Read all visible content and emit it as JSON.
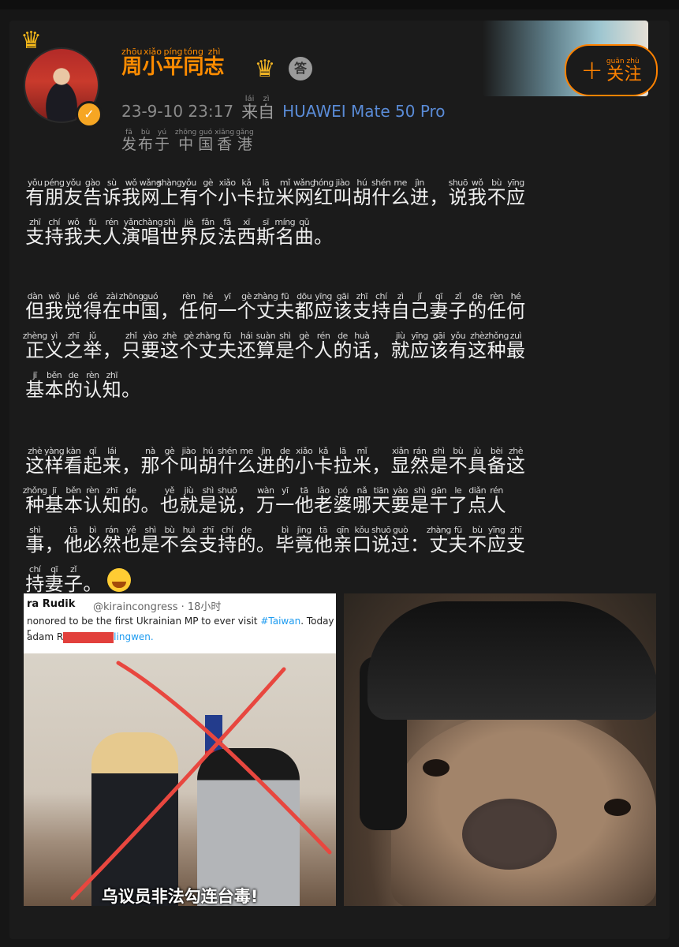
{
  "user": {
    "name": [
      {
        "py": "zhōu",
        "hz": "周"
      },
      {
        "py": "xiǎo",
        "hz": "小"
      },
      {
        "py": "píng",
        "hz": "平"
      },
      {
        "py": "tóng",
        "hz": "同"
      },
      {
        "py": "zhì",
        "hz": "志"
      }
    ],
    "timestamp": "23-9-10 23:17",
    "source_label": [
      {
        "py": "lái",
        "hz": "来"
      },
      {
        "py": "zì",
        "hz": "自"
      }
    ],
    "device": "HUAWEI Mate 50 Pro",
    "location": [
      {
        "py": "fā",
        "hz": "发"
      },
      {
        "py": "bù",
        "hz": "布"
      },
      {
        "py": "yú",
        "hz": "于"
      },
      {
        "py": "",
        "hz": " "
      },
      {
        "py": "zhōng",
        "hz": "中"
      },
      {
        "py": "guó",
        "hz": "国"
      },
      {
        "py": "xiāng",
        "hz": "香"
      },
      {
        "py": "gǎng",
        "hz": "港"
      }
    ]
  },
  "follow": {
    "label": [
      {
        "py": "guān",
        "hz": "关"
      },
      {
        "py": "zhù",
        "hz": "注"
      }
    ],
    "plus": "+"
  },
  "post": {
    "paragraphs": [
      [
        [
          {
            "py": "yǒu",
            "hz": "有"
          },
          {
            "py": "péng",
            "hz": "朋"
          },
          {
            "py": "yǒu",
            "hz": "友"
          },
          {
            "py": "gào",
            "hz": "告"
          },
          {
            "py": "sù",
            "hz": "诉"
          },
          {
            "py": "wǒ",
            "hz": "我"
          },
          {
            "py": "wǎng",
            "hz": "网"
          },
          {
            "py": "shàng",
            "hz": "上"
          },
          {
            "py": "yǒu",
            "hz": "有"
          },
          {
            "py": "gè",
            "hz": "个"
          },
          {
            "py": "xiǎo",
            "hz": "小"
          },
          {
            "py": "kǎ",
            "hz": "卡"
          },
          {
            "py": "lā",
            "hz": "拉"
          },
          {
            "py": "mǐ",
            "hz": "米"
          },
          {
            "py": "wǎng",
            "hz": "网"
          },
          {
            "py": "hóng",
            "hz": "红"
          },
          {
            "py": "jiào",
            "hz": "叫"
          },
          {
            "py": "hú",
            "hz": "胡"
          },
          {
            "py": "shén",
            "hz": "什"
          },
          {
            "py": "me",
            "hz": "么"
          },
          {
            "py": "jìn",
            "hz": "进"
          },
          {
            "py": "",
            "hz": "，"
          },
          {
            "py": "shuō",
            "hz": "说"
          },
          {
            "py": "wǒ",
            "hz": "我"
          },
          {
            "py": "bù",
            "hz": "不"
          },
          {
            "py": "yīng",
            "hz": "应"
          }
        ],
        [
          {
            "py": "zhī",
            "hz": "支"
          },
          {
            "py": "chí",
            "hz": "持"
          },
          {
            "py": "wǒ",
            "hz": "我"
          },
          {
            "py": "fū",
            "hz": "夫"
          },
          {
            "py": "rén",
            "hz": "人"
          },
          {
            "py": "yǎn",
            "hz": "演"
          },
          {
            "py": "chàng",
            "hz": "唱"
          },
          {
            "py": "shì",
            "hz": "世"
          },
          {
            "py": "jiè",
            "hz": "界"
          },
          {
            "py": "fǎn",
            "hz": "反"
          },
          {
            "py": "fǎ",
            "hz": "法"
          },
          {
            "py": "xī",
            "hz": "西"
          },
          {
            "py": "sī",
            "hz": "斯"
          },
          {
            "py": "míng",
            "hz": "名"
          },
          {
            "py": "qǔ",
            "hz": "曲"
          },
          {
            "py": "",
            "hz": "。"
          }
        ]
      ],
      [
        [
          {
            "py": "dàn",
            "hz": "但"
          },
          {
            "py": "wǒ",
            "hz": "我"
          },
          {
            "py": "jué",
            "hz": "觉"
          },
          {
            "py": "dé",
            "hz": "得"
          },
          {
            "py": "zài",
            "hz": "在"
          },
          {
            "py": "zhōng",
            "hz": "中"
          },
          {
            "py": "guó",
            "hz": "国"
          },
          {
            "py": "",
            "hz": "，"
          },
          {
            "py": "rèn",
            "hz": "任"
          },
          {
            "py": "hé",
            "hz": "何"
          },
          {
            "py": "yī",
            "hz": "一"
          },
          {
            "py": "gè",
            "hz": "个"
          },
          {
            "py": "zhàng",
            "hz": "丈"
          },
          {
            "py": "fū",
            "hz": "夫"
          },
          {
            "py": "dōu",
            "hz": "都"
          },
          {
            "py": "yīng",
            "hz": "应"
          },
          {
            "py": "gāi",
            "hz": "该"
          },
          {
            "py": "zhī",
            "hz": "支"
          },
          {
            "py": "chí",
            "hz": "持"
          },
          {
            "py": "zì",
            "hz": "自"
          },
          {
            "py": "jǐ",
            "hz": "己"
          },
          {
            "py": "qī",
            "hz": "妻"
          },
          {
            "py": "zǐ",
            "hz": "子"
          },
          {
            "py": "de",
            "hz": "的"
          },
          {
            "py": "rèn",
            "hz": "任"
          },
          {
            "py": "hé",
            "hz": "何"
          }
        ],
        [
          {
            "py": "zhèng",
            "hz": "正"
          },
          {
            "py": "yì",
            "hz": "义"
          },
          {
            "py": "zhī",
            "hz": "之"
          },
          {
            "py": "jǔ",
            "hz": "举"
          },
          {
            "py": "",
            "hz": "，"
          },
          {
            "py": "zhǐ",
            "hz": "只"
          },
          {
            "py": "yào",
            "hz": "要"
          },
          {
            "py": "zhè",
            "hz": "这"
          },
          {
            "py": "gè",
            "hz": "个"
          },
          {
            "py": "zhàng",
            "hz": "丈"
          },
          {
            "py": "fū",
            "hz": "夫"
          },
          {
            "py": "hái",
            "hz": "还"
          },
          {
            "py": "suàn",
            "hz": "算"
          },
          {
            "py": "shì",
            "hz": "是"
          },
          {
            "py": "gè",
            "hz": "个"
          },
          {
            "py": "rén",
            "hz": "人"
          },
          {
            "py": "de",
            "hz": "的"
          },
          {
            "py": "huà",
            "hz": "话"
          },
          {
            "py": "",
            "hz": "，"
          },
          {
            "py": "jiù",
            "hz": "就"
          },
          {
            "py": "yīng",
            "hz": "应"
          },
          {
            "py": "gāi",
            "hz": "该"
          },
          {
            "py": "yǒu",
            "hz": "有"
          },
          {
            "py": "zhè",
            "hz": "这"
          },
          {
            "py": "zhǒng",
            "hz": "种"
          },
          {
            "py": "zuì",
            "hz": "最"
          }
        ],
        [
          {
            "py": "jī",
            "hz": "基"
          },
          {
            "py": "běn",
            "hz": "本"
          },
          {
            "py": "de",
            "hz": "的"
          },
          {
            "py": "rèn",
            "hz": "认"
          },
          {
            "py": "zhī",
            "hz": "知"
          },
          {
            "py": "",
            "hz": "。"
          }
        ]
      ],
      [
        [
          {
            "py": "zhè",
            "hz": "这"
          },
          {
            "py": "yàng",
            "hz": "样"
          },
          {
            "py": "kàn",
            "hz": "看"
          },
          {
            "py": "qǐ",
            "hz": "起"
          },
          {
            "py": "lái",
            "hz": "来"
          },
          {
            "py": "",
            "hz": "，"
          },
          {
            "py": "nà",
            "hz": "那"
          },
          {
            "py": "gè",
            "hz": "个"
          },
          {
            "py": "jiào",
            "hz": "叫"
          },
          {
            "py": "hú",
            "hz": "胡"
          },
          {
            "py": "shén",
            "hz": "什"
          },
          {
            "py": "me",
            "hz": "么"
          },
          {
            "py": "jìn",
            "hz": "进"
          },
          {
            "py": "de",
            "hz": "的"
          },
          {
            "py": "xiǎo",
            "hz": "小"
          },
          {
            "py": "kǎ",
            "hz": "卡"
          },
          {
            "py": "lā",
            "hz": "拉"
          },
          {
            "py": "mǐ",
            "hz": "米"
          },
          {
            "py": "",
            "hz": "，"
          },
          {
            "py": "xiǎn",
            "hz": "显"
          },
          {
            "py": "rán",
            "hz": "然"
          },
          {
            "py": "shì",
            "hz": "是"
          },
          {
            "py": "bù",
            "hz": "不"
          },
          {
            "py": "jù",
            "hz": "具"
          },
          {
            "py": "bèi",
            "hz": "备"
          },
          {
            "py": "zhè",
            "hz": "这"
          }
        ],
        [
          {
            "py": "zhǒng",
            "hz": "种"
          },
          {
            "py": "jī",
            "hz": "基"
          },
          {
            "py": "běn",
            "hz": "本"
          },
          {
            "py": "rèn",
            "hz": "认"
          },
          {
            "py": "zhī",
            "hz": "知"
          },
          {
            "py": "de",
            "hz": "的"
          },
          {
            "py": "",
            "hz": "。"
          },
          {
            "py": "yě",
            "hz": "也"
          },
          {
            "py": "jiù",
            "hz": "就"
          },
          {
            "py": "shì",
            "hz": "是"
          },
          {
            "py": "shuō",
            "hz": "说"
          },
          {
            "py": "",
            "hz": "，"
          },
          {
            "py": "wàn",
            "hz": "万"
          },
          {
            "py": "yī",
            "hz": "一"
          },
          {
            "py": "tā",
            "hz": "他"
          },
          {
            "py": "lǎo",
            "hz": "老"
          },
          {
            "py": "pó",
            "hz": "婆"
          },
          {
            "py": "nǎ",
            "hz": "哪"
          },
          {
            "py": "tiān",
            "hz": "天"
          },
          {
            "py": "yào",
            "hz": "要"
          },
          {
            "py": "shì",
            "hz": "是"
          },
          {
            "py": "gān",
            "hz": "干"
          },
          {
            "py": "le",
            "hz": "了"
          },
          {
            "py": "diǎn",
            "hz": "点"
          },
          {
            "py": "rén",
            "hz": "人"
          }
        ],
        [
          {
            "py": "shì",
            "hz": "事"
          },
          {
            "py": "",
            "hz": "，"
          },
          {
            "py": "tā",
            "hz": "他"
          },
          {
            "py": "bì",
            "hz": "必"
          },
          {
            "py": "rán",
            "hz": "然"
          },
          {
            "py": "yě",
            "hz": "也"
          },
          {
            "py": "shì",
            "hz": "是"
          },
          {
            "py": "bù",
            "hz": "不"
          },
          {
            "py": "huì",
            "hz": "会"
          },
          {
            "py": "zhī",
            "hz": "支"
          },
          {
            "py": "chí",
            "hz": "持"
          },
          {
            "py": "de",
            "hz": "的"
          },
          {
            "py": "",
            "hz": "。"
          },
          {
            "py": "bì",
            "hz": "毕"
          },
          {
            "py": "jìng",
            "hz": "竟"
          },
          {
            "py": "tā",
            "hz": "他"
          },
          {
            "py": "qīn",
            "hz": "亲"
          },
          {
            "py": "kǒu",
            "hz": "口"
          },
          {
            "py": "shuō",
            "hz": "说"
          },
          {
            "py": "guò",
            "hz": "过"
          },
          {
            "py": "",
            "hz": "："
          },
          {
            "py": "zhàng",
            "hz": "丈"
          },
          {
            "py": "fū",
            "hz": "夫"
          },
          {
            "py": "bù",
            "hz": "不"
          },
          {
            "py": "yīng",
            "hz": "应"
          },
          {
            "py": "zhī",
            "hz": "支"
          }
        ],
        [
          {
            "py": "chí",
            "hz": "持"
          },
          {
            "py": "qī",
            "hz": "妻"
          },
          {
            "py": "zǐ",
            "hz": "子"
          },
          {
            "py": "",
            "hz": "。"
          }
        ]
      ]
    ],
    "emoji": "laugh-cry-emoji"
  },
  "image_left": {
    "tweet_name": "ra Rudik",
    "tweet_handle": "@kiraincongress · 18小时",
    "tweet_line1a": "nonored to be the first Ukrainian MP to ever visit ",
    "tweet_line1_hashtag": "#Taiwan",
    "tweet_line1b": ". Today r",
    "tweet_line2": "adam R",
    "tweet_line2b": "lingwen.",
    "caption": "乌议员非法勾连台毒!",
    "cross_color": "#e8473f"
  },
  "image_right": {
    "subject": "dog-with-wig"
  },
  "colors": {
    "accent": "#ff8200",
    "username": "#ff8c00",
    "device_link": "#5a8bd6",
    "bg": "#1b1b1b"
  }
}
